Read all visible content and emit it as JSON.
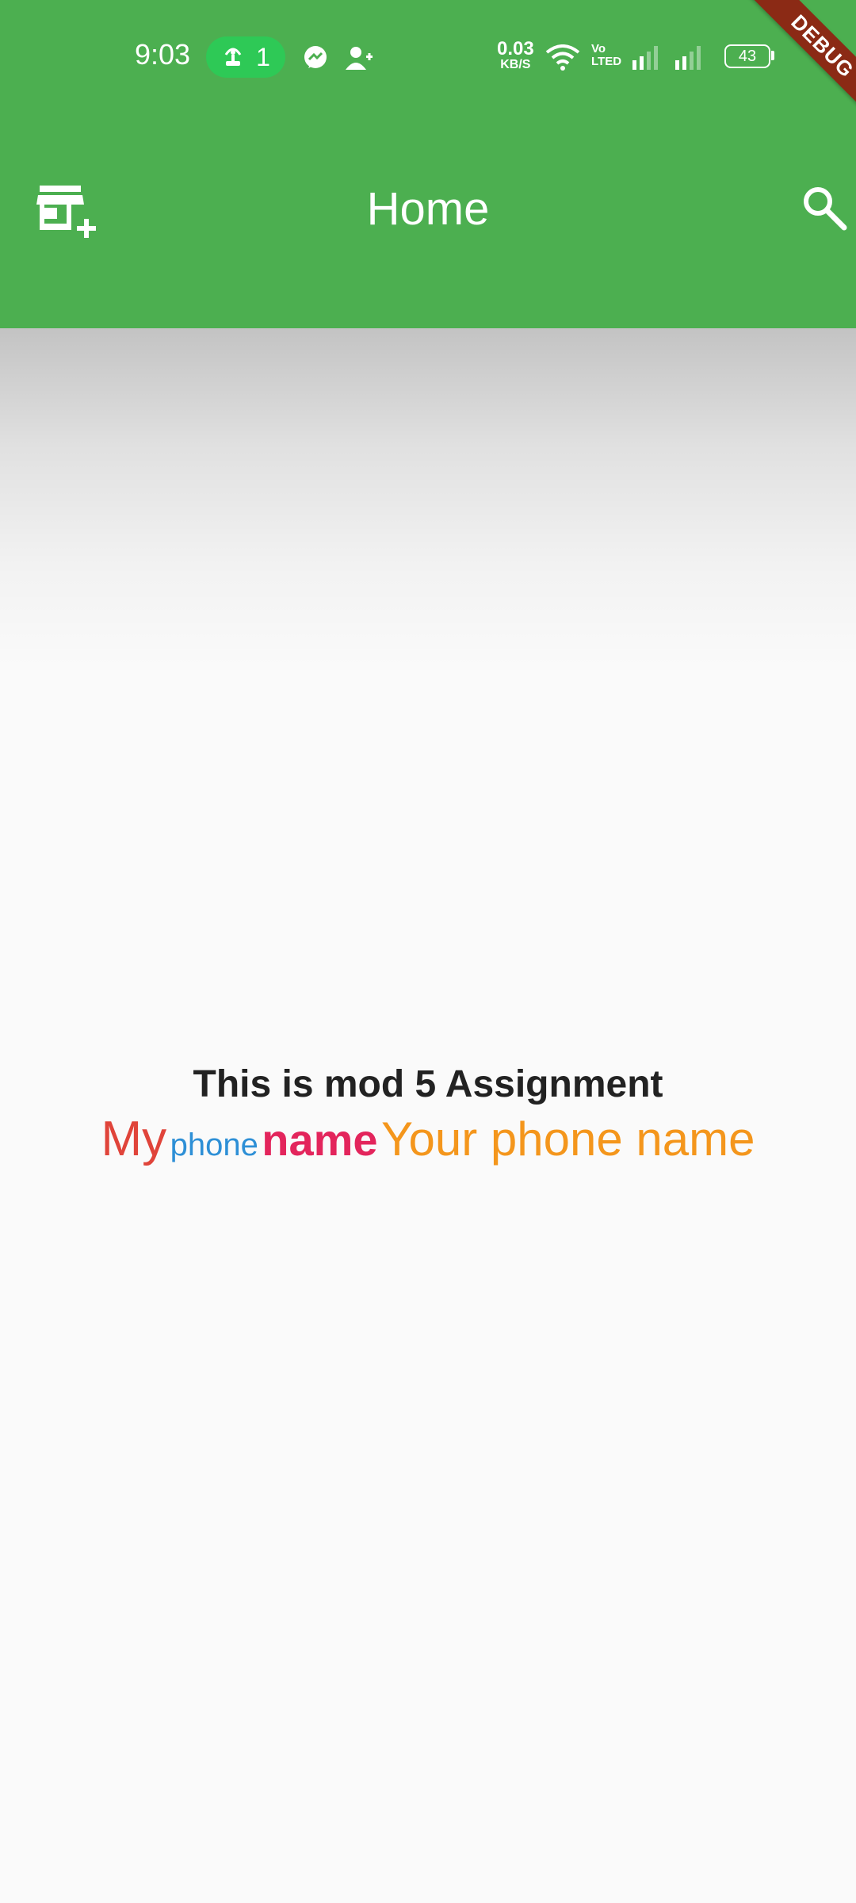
{
  "status_bar": {
    "time": "9:03",
    "hotspot_count": "1",
    "net_speed_value": "0.03",
    "net_speed_unit": "KB/S",
    "volte_top": "Vo",
    "volte_bottom": "LTED",
    "battery": "43"
  },
  "debug_banner": "DEBUG",
  "app_bar": {
    "title": "Home",
    "left_icon": "add-business-icon",
    "right_icon": "search-icon",
    "color": "#4caf50"
  },
  "body": {
    "heading": "This is mod 5 Assignment",
    "rich_text": {
      "my": "My",
      "phone": "phone",
      "name": "name",
      "your": "Your phone name"
    },
    "colors": {
      "my": "#e0443a",
      "phone": "#2d8fd6",
      "name": "#e3255c",
      "your": "#f4961c"
    }
  }
}
